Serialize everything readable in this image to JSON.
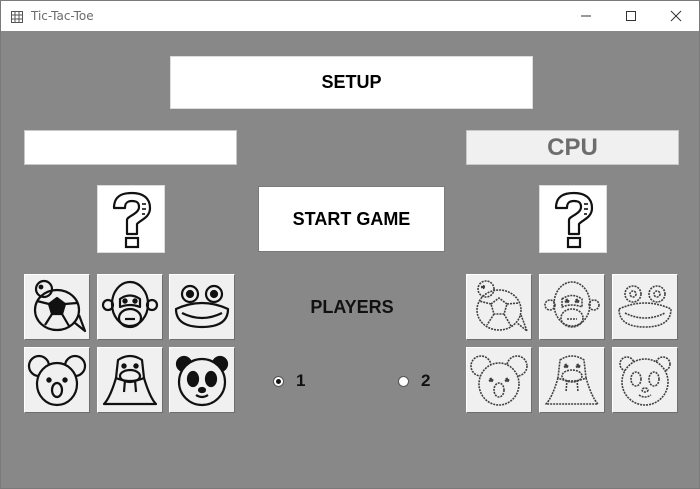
{
  "window": {
    "title": "Tic-Tac-Toe",
    "app_icon": "grid-icon"
  },
  "controls": {
    "minimize": "minimize-icon",
    "maximize": "maximize-icon",
    "close": "close-icon"
  },
  "setup_label": "SETUP",
  "player1": {
    "name_value": "",
    "piece": "question-mark-icon"
  },
  "player2": {
    "name_value": "CPU",
    "piece": "question-mark-icon"
  },
  "start_label": "START GAME",
  "players_label": "PLAYERS",
  "radios": [
    {
      "label": "1",
      "checked": true
    },
    {
      "label": "2",
      "checked": false
    }
  ],
  "animals": [
    "turtle",
    "monkey",
    "frog",
    "koala",
    "walrus",
    "panda"
  ],
  "colors": {
    "background": "#888888",
    "button": "#ffffff",
    "cpu_text": "#6d6d6d"
  }
}
